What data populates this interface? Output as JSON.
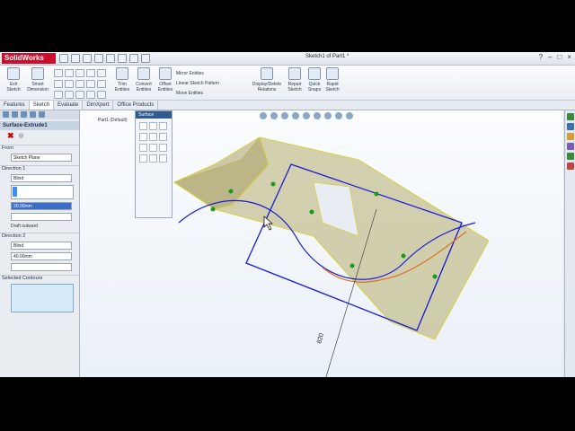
{
  "app": {
    "name": "SolidWorks",
    "document_title": "Sketch1 of Part1 *"
  },
  "window_controls": [
    "?",
    "–",
    "□",
    "×"
  ],
  "ribbon": {
    "buttons": [
      {
        "label": "Exit Sketch",
        "icon": "exit-sketch-icon"
      },
      {
        "label": "Smart Dimension",
        "icon": "smart-dimension-icon"
      },
      {
        "label": "Trim Entities",
        "icon": "trim-icon"
      },
      {
        "label": "Convert Entities",
        "icon": "convert-icon"
      },
      {
        "label": "Offset Entities",
        "icon": "offset-icon"
      },
      {
        "label": "Display/Delete Relations",
        "icon": "relations-icon"
      },
      {
        "label": "Repair Sketch",
        "icon": "repair-icon"
      },
      {
        "label": "Quick Snaps",
        "icon": "snaps-icon"
      },
      {
        "label": "Rapid Sketch",
        "icon": "rapid-sketch-icon"
      }
    ],
    "text_commands": [
      "Mirror Entities",
      "Linear Sketch Pattern",
      "Move Entities"
    ]
  },
  "tabs": [
    "Features",
    "Sketch",
    "Evaluate",
    "DimXpert",
    "Office Products"
  ],
  "active_tab": "Sketch",
  "property_manager": {
    "title": "Surface-Extrude1",
    "from_label": "From",
    "from_value": "Sketch Plane",
    "direction1_label": "Direction 1",
    "direction1_type": "Blind",
    "direction1_depth": "20.00mm",
    "draft_outward": "Draft outward",
    "direction2_label": "Direction 2",
    "direction2_type": "Blind",
    "direction2_depth": "40.00mm",
    "selected_contours_label": "Selected Contours"
  },
  "viewport": {
    "tree_label": "Part1 (Default)",
    "dimension_label": "820",
    "floating_palette_title": "Surface"
  },
  "colors": {
    "accent": "#c8102e",
    "sketch": "#1a1ad8",
    "surface": "#b5ad6e"
  }
}
